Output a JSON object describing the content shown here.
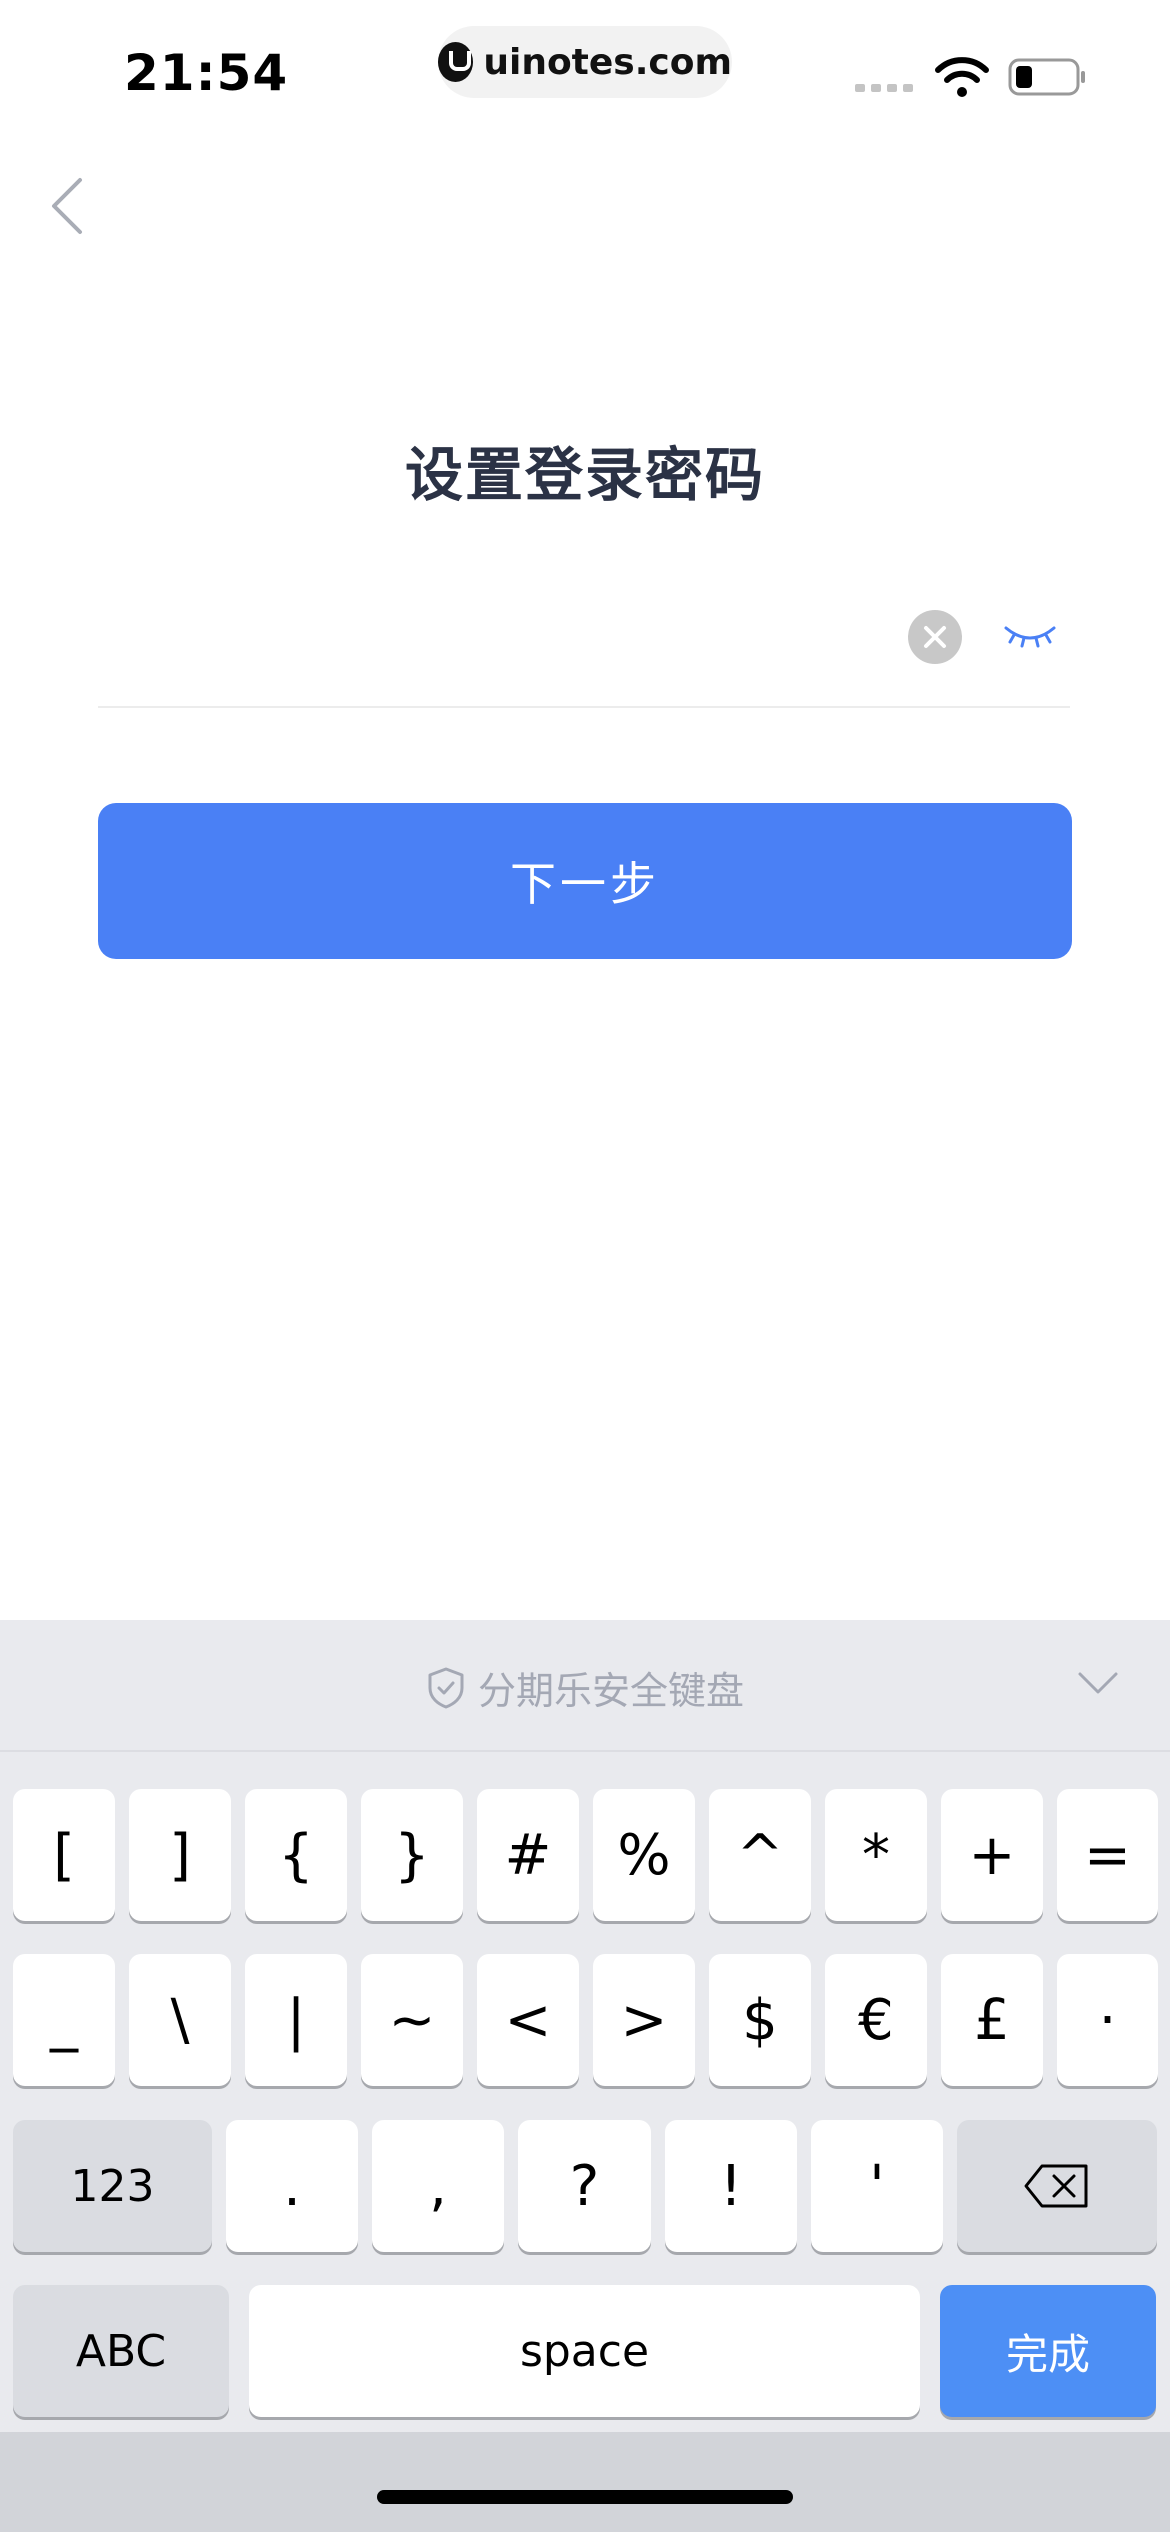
{
  "status_bar": {
    "time": "21:54",
    "url": "uinotes.com"
  },
  "page": {
    "title": "设置登录密码",
    "password_value": "",
    "next_button": "下一步"
  },
  "keyboard": {
    "header": "分期乐安全键盘",
    "row1": [
      "[",
      "]",
      "{",
      "}",
      "#",
      "%",
      "^",
      "*",
      "+",
      "="
    ],
    "row2": [
      "_",
      "\\",
      "|",
      "~",
      "<",
      ">",
      "$",
      "€",
      "£",
      "·"
    ],
    "row3": {
      "mode": "123",
      "keys": [
        ".",
        ",",
        "?",
        "!",
        "'"
      ]
    },
    "row4": {
      "abc": "ABC",
      "space": "space",
      "done": "完成"
    }
  },
  "colors": {
    "accent": "#4a80f5",
    "title": "#2b3245",
    "done_key": "#4d8ff5"
  }
}
